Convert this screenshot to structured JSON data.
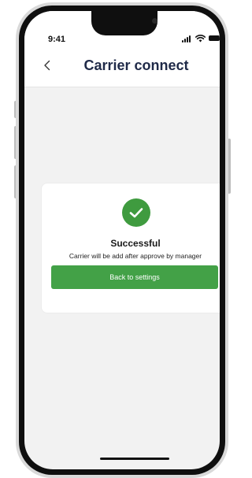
{
  "status_bar": {
    "time": "9:41",
    "icons": [
      "signal-icon",
      "wifi-icon",
      "battery-icon"
    ]
  },
  "header": {
    "back_icon": "chevron-left-icon",
    "title": "Carrier connect"
  },
  "result_card": {
    "icon": "check-circle-icon",
    "title": "Successful",
    "message": "Carrier will be add after approve by manager",
    "button_label": "Back to settings"
  },
  "colors": {
    "accent_green": "#43a147",
    "title_navy": "#1f2a48",
    "screen_background": "#f2f2f2"
  }
}
